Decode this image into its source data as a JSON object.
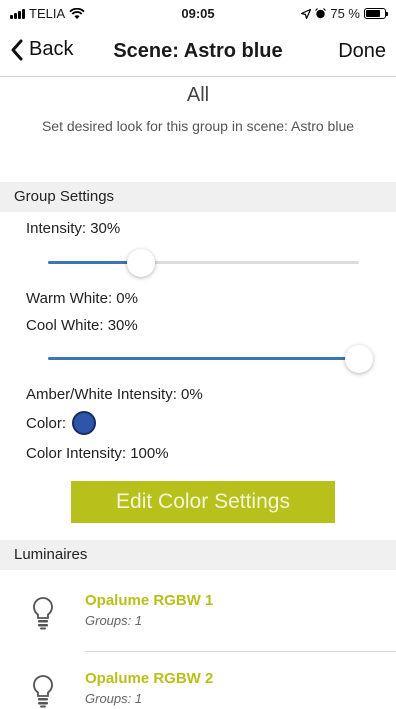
{
  "status_bar": {
    "carrier": "TELIA",
    "time": "09:05",
    "battery": "75 %",
    "battery_level": 0.75
  },
  "nav": {
    "back_label": "Back",
    "title": "Scene: Astro blue",
    "done_label": "Done"
  },
  "group": {
    "name": "All",
    "description": "Set desired look for this group in scene: Astro blue"
  },
  "group_settings": {
    "header": "Group Settings",
    "intensity_label": "Intensity: 30%",
    "intensity_value": 0.3,
    "warm_white_label": "Warm White: 0%",
    "cool_white_label": "Cool White: 30%",
    "cool_white_slider": 1.0,
    "amber_label": "Amber/White Intensity: 0%",
    "color_label": "Color:",
    "color_hex": "#2d55a9",
    "color_intensity_label": "Color Intensity: 100%",
    "edit_color_label": "Edit Color Settings"
  },
  "luminaires": {
    "header": "Luminaires",
    "items": [
      {
        "name": "Opalume RGBW 1",
        "groups": "Groups: 1"
      },
      {
        "name": "Opalume RGBW 2",
        "groups": "Groups: 1"
      }
    ]
  },
  "colors": {
    "accent": "#b8c01c",
    "slider": "#3c74b8"
  }
}
